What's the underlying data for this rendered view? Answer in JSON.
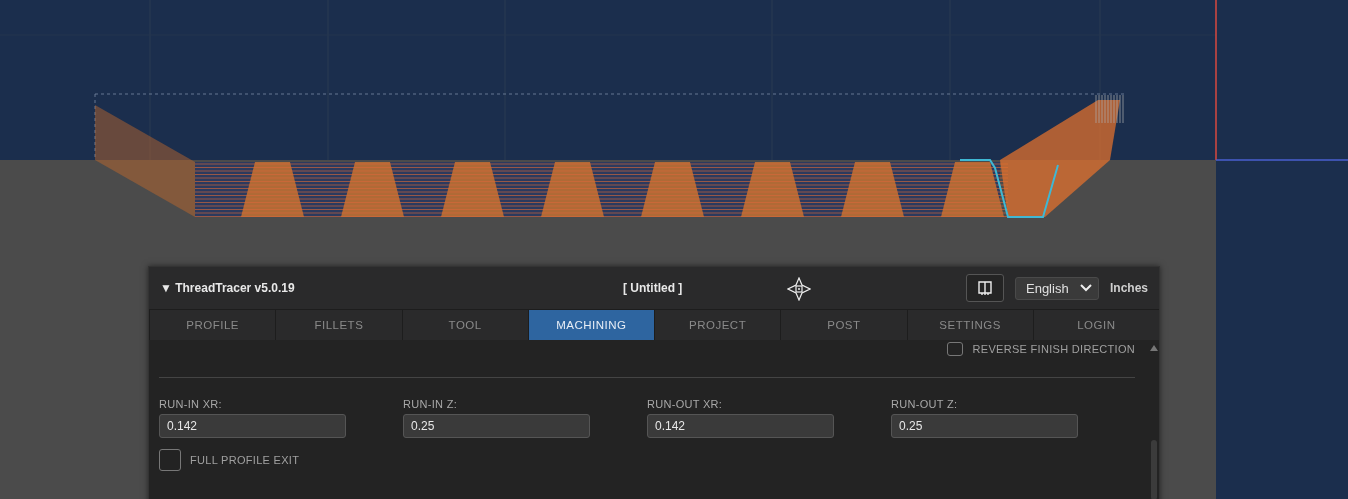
{
  "header": {
    "collapse_glyph": "▼",
    "title": "ThreadTracer v5.0.19",
    "document": "[ Untitled ]",
    "language": "English",
    "units": "Inches"
  },
  "tabs": [
    {
      "label": "PROFILE",
      "selected": false
    },
    {
      "label": "FILLETS",
      "selected": false
    },
    {
      "label": "TOOL",
      "selected": false
    },
    {
      "label": "MACHINING",
      "selected": true
    },
    {
      "label": "PROJECT",
      "selected": false
    },
    {
      "label": "POST",
      "selected": false
    },
    {
      "label": "SETTINGS",
      "selected": false
    },
    {
      "label": "LOGIN",
      "selected": false
    }
  ],
  "reverse_finish": {
    "label": "REVERSE FINISH DIRECTION",
    "checked": false
  },
  "fields": [
    {
      "label": "RUN-IN XR:",
      "value": "0.142"
    },
    {
      "label": "RUN-IN Z:",
      "value": "0.25"
    },
    {
      "label": "RUN-OUT XR:",
      "value": "0.142"
    },
    {
      "label": "RUN-OUT Z:",
      "value": "0.25"
    }
  ],
  "full_profile_exit": {
    "label": "FULL PROFILE EXIT",
    "checked": false
  }
}
